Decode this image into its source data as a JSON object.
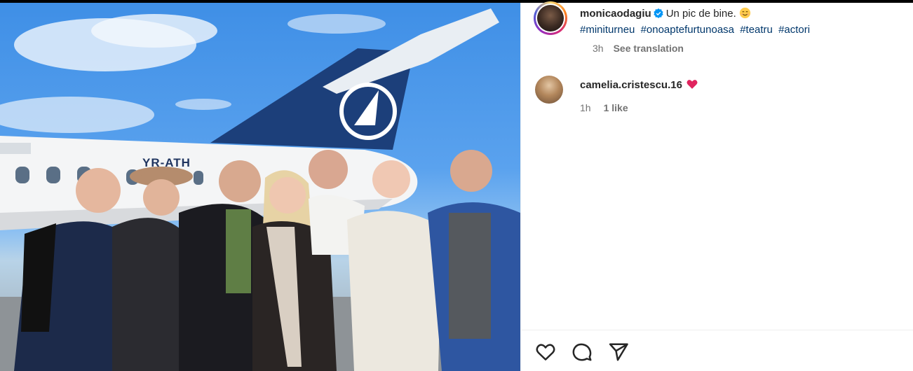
{
  "post": {
    "author": "monicaodagiu",
    "verified": true,
    "caption": "Un pic de bine.",
    "caption_emoji": "smiling-face-icon",
    "hashtags": [
      "#miniturneu",
      "#onoaptefurtunoasa",
      "#teatru",
      "#actori"
    ],
    "time_ago": "3h",
    "see_translation": "See translation"
  },
  "photo": {
    "aircraft_registration": "YR-ATH"
  },
  "comments": [
    {
      "author": "camelia.cristescu.16",
      "emoji": "red-heart-icon",
      "time_ago": "1h",
      "likes": "1 like"
    }
  ],
  "actions": {
    "icons": [
      "heart-icon",
      "comment-icon",
      "share-icon"
    ]
  },
  "colors": {
    "text": "#262626",
    "muted": "#737373",
    "hashtag": "#00376b",
    "verified_blue": "#0095f6",
    "heart_red": "#ff3040"
  }
}
